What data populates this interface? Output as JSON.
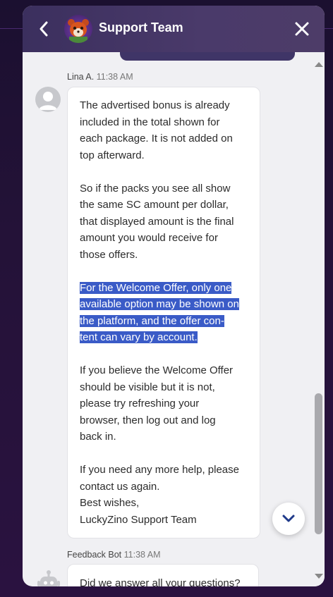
{
  "header": {
    "title": "Support Team",
    "back_icon": "chevron-left-icon",
    "close_icon": "close-icon"
  },
  "message1": {
    "sender": "Lina A.",
    "time": "11:38 AM",
    "paragraph1": [
      "The advertised bonus is already",
      "included in the total shown for",
      "each package. It is not added on",
      "top afterward."
    ],
    "paragraph2": [
      "So if the packs you see all show",
      "the same SC amount per dollar,",
      "that displayed amount is the final",
      "amount you would receive for",
      "those offers."
    ],
    "paragraph3": [
      "For the Welcome Offer, only one",
      "available option may be shown on",
      "the platform, and the offer con-",
      "tent can vary by account."
    ],
    "paragraph4": [
      "If you believe the Welcome Offer",
      "should be visible but it is not,",
      "please try refreshing your",
      "browser, then log out and log",
      "back in."
    ],
    "paragraph5": [
      "If you need any more help, please",
      "contact us again.",
      "Best wishes,",
      "LuckyZino Support Team"
    ]
  },
  "message2": {
    "sender": "Feedback Bot",
    "time": "11:38 AM",
    "text": "Did we answer all your questions?"
  },
  "colors": {
    "header": "#4a3a6a",
    "highlight": "#3a5bc7",
    "panel": "#f0f0f3"
  }
}
